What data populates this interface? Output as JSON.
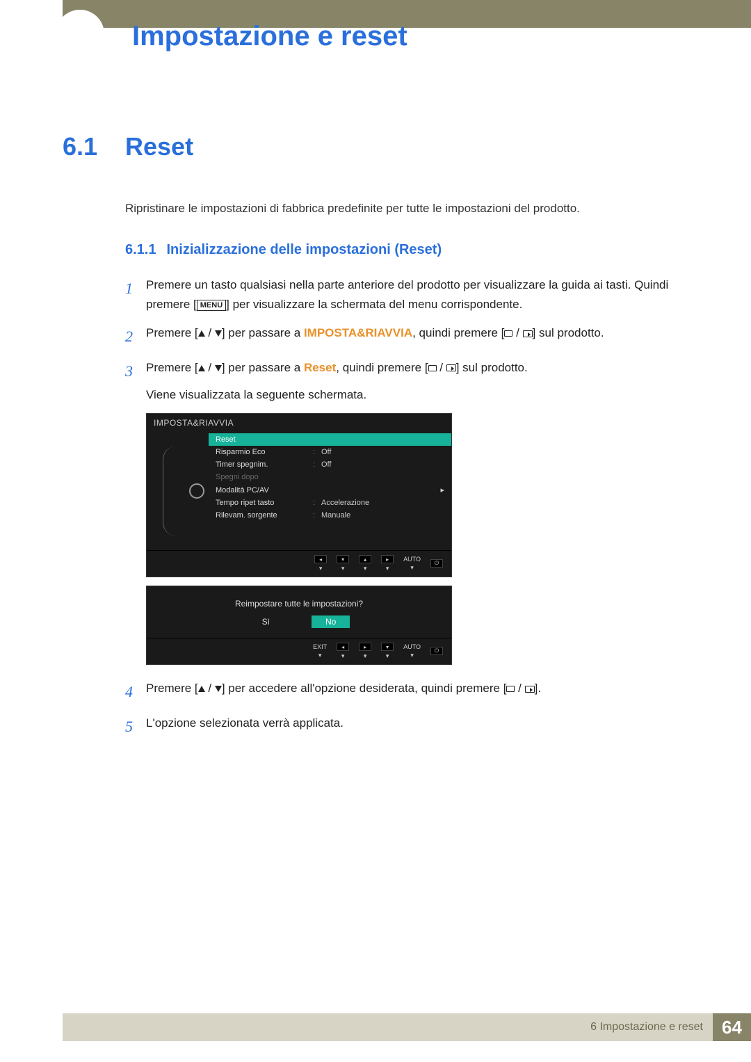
{
  "header": {
    "chapter_title": "Impostazione e reset"
  },
  "section": {
    "num": "6.1",
    "name": "Reset"
  },
  "intro": "Ripristinare le impostazioni di fabbrica predefinite per tutte le impostazioni del prodotto.",
  "subsection": {
    "num": "6.1.1",
    "name": "Inizializzazione delle impostazioni (Reset)"
  },
  "steps": {
    "s1": {
      "num": "1",
      "pre": "Premere un tasto qualsiasi nella parte anteriore del prodotto per visualizzare la guida ai tasti. Quindi premere [",
      "menu": "MENU",
      "post": "] per visualizzare la schermata del menu corrispondente."
    },
    "s2": {
      "num": "2",
      "pre": "Premere [",
      "mid1": "] per passare a ",
      "hl": "IMPOSTA&RIAVVIA",
      "mid2": ", quindi premere [",
      "post": "] sul prodotto."
    },
    "s3": {
      "num": "3",
      "pre": "Premere [",
      "mid1": "] per passare a ",
      "hl": "Reset",
      "mid2": ", quindi premere [",
      "post": "] sul prodotto.",
      "after": "Viene visualizzata la seguente schermata."
    },
    "s4": {
      "num": "4",
      "pre": "Premere [",
      "mid": "] per accedere all'opzione desiderata, quindi premere [",
      "post": "]."
    },
    "s5": {
      "num": "5",
      "text": "L'opzione selezionata verrà applicata."
    }
  },
  "osd": {
    "title": "IMPOSTA&RIAVVIA",
    "items": [
      {
        "label": "Reset",
        "value": "",
        "sel": true
      },
      {
        "label": "Risparmio Eco",
        "value": "Off"
      },
      {
        "label": "Timer spegnim.",
        "value": "Off"
      },
      {
        "label": "Spegni dopo",
        "value": "",
        "dim": true
      },
      {
        "label": "Modalità PC/AV",
        "value": "",
        "arrow": true
      },
      {
        "label": "Tempo ripet tasto",
        "value": "Accelerazione"
      },
      {
        "label": "Rilevam. sorgente",
        "value": "Manuale"
      }
    ],
    "bottom": {
      "auto": "AUTO"
    },
    "confirm": {
      "question": "Reimpostare tutte le impostazioni?",
      "yes": "Sì",
      "no": "No",
      "exit": "EXIT",
      "auto": "AUTO"
    }
  },
  "footer": {
    "chapter_ref": "6 Impostazione e reset",
    "page": "64"
  }
}
